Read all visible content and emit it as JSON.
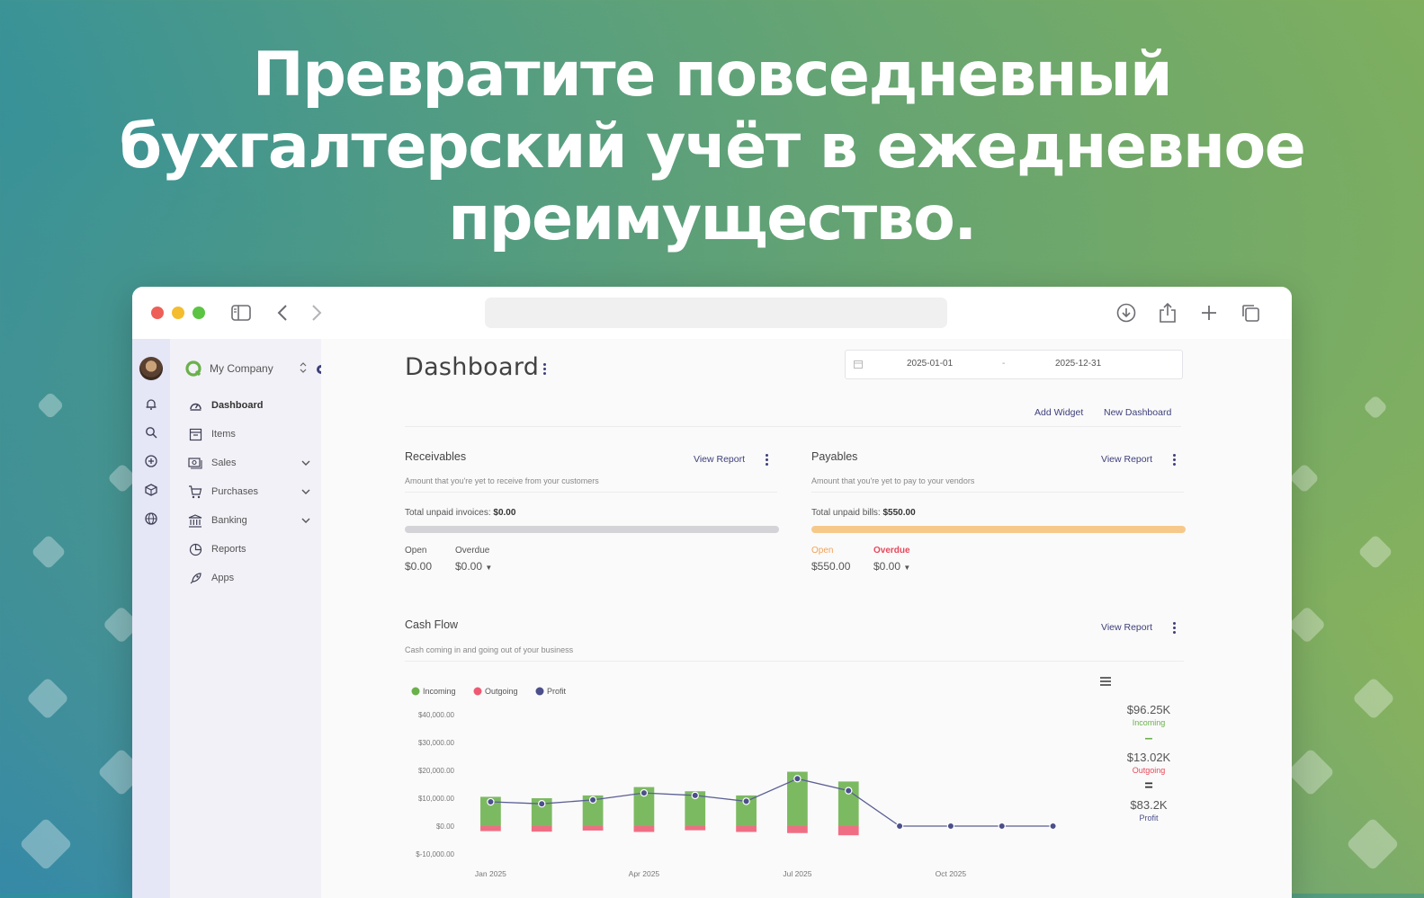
{
  "headline": {
    "line1": "Превратите повседневный",
    "line2": "бухгалтерский учёт в ежедневное",
    "line3": "преимущество."
  },
  "browser": {
    "traffic_lights": [
      "#ed5f57",
      "#f4bd2f",
      "#5bc442"
    ],
    "icons": [
      "sidebar-icon",
      "back-icon",
      "forward-icon",
      "download-icon",
      "share-icon",
      "new-tab-icon",
      "tabs-icon"
    ]
  },
  "sidebar": {
    "company": "My Company",
    "rail_icons": [
      "bell-icon",
      "search-icon",
      "add-circle-icon",
      "cube-icon",
      "globe-icon"
    ],
    "items": [
      {
        "label": "Dashboard",
        "icon": "gauge-icon",
        "active": true
      },
      {
        "label": "Items",
        "icon": "box-icon"
      },
      {
        "label": "Sales",
        "icon": "money-icon",
        "expandable": true
      },
      {
        "label": "Purchases",
        "icon": "cart-icon",
        "expandable": true
      },
      {
        "label": "Banking",
        "icon": "bank-icon",
        "expandable": true
      },
      {
        "label": "Reports",
        "icon": "chart-icon"
      },
      {
        "label": "Apps",
        "icon": "rocket-icon"
      }
    ]
  },
  "dashboard": {
    "title": "Dashboard",
    "date_from": "2025-01-01",
    "date_sep": "-",
    "date_to": "2025-12-31",
    "add_widget": "Add Widget",
    "new_dashboard": "New Dashboard"
  },
  "receivables": {
    "title": "Receivables",
    "view_report": "View Report",
    "subtitle": "Amount that you're yet to receive from your customers",
    "total_label": "Total unpaid invoices:",
    "total_value": "$0.00",
    "open_label": "Open",
    "open_value": "$0.00",
    "overdue_label": "Overdue",
    "overdue_value": "$0.00",
    "bar_color": "#d3d3d8"
  },
  "payables": {
    "title": "Payables",
    "view_report": "View Report",
    "subtitle": "Amount that you're yet to pay to your vendors",
    "total_label": "Total unpaid bills:",
    "total_value": "$550.00",
    "open_label": "Open",
    "open_value": "$550.00",
    "overdue_label": "Overdue",
    "overdue_value": "$0.00",
    "bar_color": "#f6c98a",
    "open_color": "#f2a25a",
    "overdue_color": "#e8475a"
  },
  "cashflow": {
    "title": "Cash Flow",
    "view_report": "View Report",
    "subtitle": "Cash coming in and going out of your business",
    "summary": [
      {
        "value": "$96.25K",
        "label": "Incoming",
        "color": "#6ab04c"
      },
      {
        "op": "–"
      },
      {
        "value": "$13.02K",
        "label": "Outgoing",
        "color": "#e8475a"
      },
      {
        "op": "="
      },
      {
        "value": "$83.2K",
        "label": "Profit",
        "color": "#4b4f8a"
      }
    ]
  },
  "chart_data": {
    "type": "bar",
    "legend": [
      "Incoming",
      "Outgoing",
      "Profit"
    ],
    "legend_colors": [
      "#6ab04c",
      "#ee5a72",
      "#4b4f8a"
    ],
    "legend_position": "top-left",
    "y_ticks": [
      "$40,000.00",
      "$30,000.00",
      "$20,000.00",
      "$10,000.00",
      "$0.00",
      "$-10,000.00"
    ],
    "ylim": [
      -10000,
      40000
    ],
    "x_labels": [
      "Jan 2025",
      "Apr 2025",
      "Jul 2025",
      "Oct 2025"
    ],
    "categories": [
      "Jan 2025",
      "Feb 2025",
      "Mar 2025",
      "Apr 2025",
      "May 2025",
      "Jun 2025",
      "Jul 2025",
      "Aug 2025",
      "Sep 2025",
      "Oct 2025",
      "Nov 2025",
      "Dec 2025"
    ],
    "series": [
      {
        "name": "Incoming",
        "values": [
          10500,
          10000,
          11000,
          14000,
          12500,
          11000,
          19500,
          16000,
          0,
          0,
          0,
          0
        ]
      },
      {
        "name": "Outgoing",
        "values": [
          -1800,
          -2000,
          -1600,
          -2100,
          -1500,
          -2100,
          -2500,
          -3300,
          0,
          0,
          0,
          0
        ]
      },
      {
        "name": "Profit",
        "values": [
          8700,
          8000,
          9400,
          11900,
          11000,
          8900,
          17000,
          12700,
          0,
          0,
          0,
          0
        ]
      }
    ]
  }
}
